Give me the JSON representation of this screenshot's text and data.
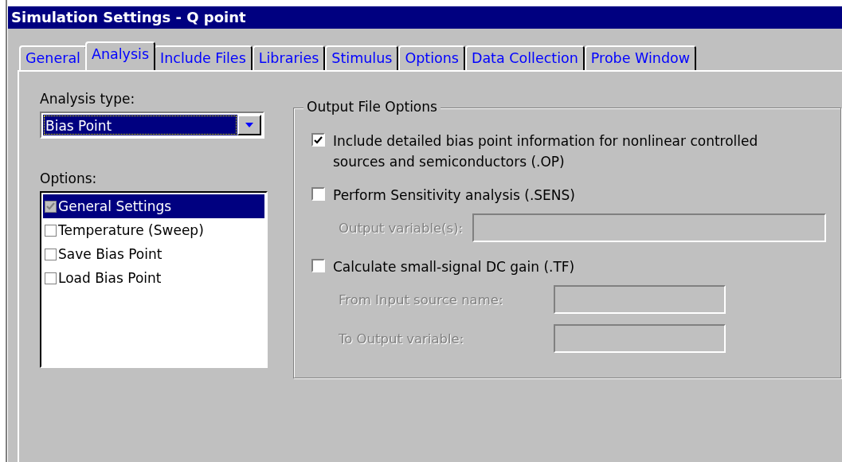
{
  "window": {
    "title": "Simulation Settings - Q point"
  },
  "tabs": [
    {
      "label": "General",
      "selected": false
    },
    {
      "label": "Analysis",
      "selected": true
    },
    {
      "label": "Include Files",
      "selected": false
    },
    {
      "label": "Libraries",
      "selected": false
    },
    {
      "label": "Stimulus",
      "selected": false
    },
    {
      "label": "Options",
      "selected": false
    },
    {
      "label": "Data Collection",
      "selected": false
    },
    {
      "label": "Probe Window",
      "selected": false
    }
  ],
  "analysis_type": {
    "label": "Analysis type:",
    "value": "Bias Point"
  },
  "options": {
    "label": "Options:",
    "items": [
      {
        "label": "General Settings",
        "checked": true,
        "disabled": true,
        "selected": true
      },
      {
        "label": "Temperature (Sweep)",
        "checked": false,
        "disabled": false,
        "selected": false
      },
      {
        "label": "Save Bias Point",
        "checked": false,
        "disabled": false,
        "selected": false
      },
      {
        "label": "Load Bias Point",
        "checked": false,
        "disabled": false,
        "selected": false
      }
    ]
  },
  "output_file_options": {
    "title": "Output File Options",
    "items": [
      {
        "label": "Include detailed bias point information for nonlinear controlled sources and semiconductors (.OP)",
        "checked": true
      },
      {
        "label": "Perform Sensitivity analysis (.SENS)",
        "checked": false,
        "fields": [
          {
            "label": "Output variable(s):",
            "disabled": true
          }
        ]
      },
      {
        "label": "Calculate small-signal DC gain (.TF)",
        "checked": false,
        "fields": [
          {
            "label": "From Input source name:",
            "disabled": true
          },
          {
            "label": "To Output variable:",
            "disabled": true
          }
        ]
      }
    ]
  }
}
